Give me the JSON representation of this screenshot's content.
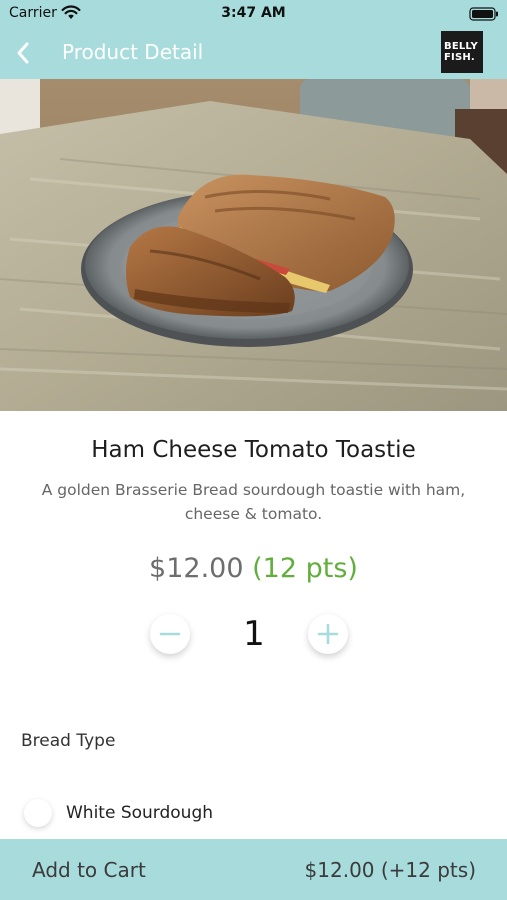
{
  "status_bar": {
    "carrier": "Carrier",
    "time": "3:47 AM",
    "wifi_icon": "wifi-icon",
    "battery_icon": "battery-icon"
  },
  "nav": {
    "title": "Product Detail",
    "back_icon": "chevron-left-icon",
    "logo_text": [
      "BELLY",
      "FISH."
    ]
  },
  "product": {
    "name": "Ham Cheese Tomato Toastie",
    "description": "A golden Brasserie Bread sourdough toastie with ham, cheese & tomato.",
    "price": "$12.00",
    "points": "(12 pts)",
    "quantity": "1",
    "image_subject": "grilled ham cheese tomato toastie on a grey plate on a wooden table"
  },
  "options": {
    "heading": "Bread Type",
    "choices": [
      {
        "label": "White Sourdough",
        "selected": false
      }
    ]
  },
  "cart": {
    "label": "Add to Cart",
    "total": "$12.00 (+12 pts)"
  },
  "colors": {
    "accent": "#a8dcdc",
    "points_green": "#62ae3c",
    "price_grey": "#6d6d6d",
    "qty_icon": "#a8dcdc"
  }
}
